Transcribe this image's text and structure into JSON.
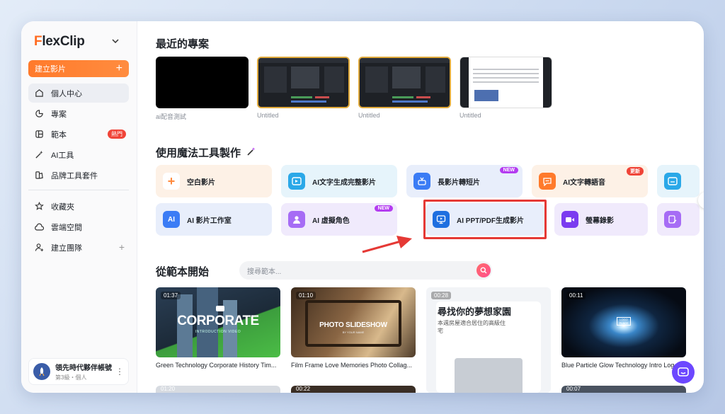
{
  "brand": {
    "name": "FlexClip",
    "first_letter": "F",
    "rest": "lexClip"
  },
  "sidebar": {
    "create_label": "建立影片",
    "items": [
      {
        "label": "個人中心",
        "icon": "home-icon",
        "active": true
      },
      {
        "label": "專案",
        "icon": "folder-icon"
      },
      {
        "label": "範本",
        "icon": "template-icon",
        "badge": "熱門"
      },
      {
        "label": "AI工具",
        "icon": "magic-wand-icon"
      },
      {
        "label": "品牌工具套件",
        "icon": "brand-kit-icon"
      },
      {
        "label": "收藏夾",
        "icon": "star-icon"
      },
      {
        "label": "雲端空間",
        "icon": "cloud-icon"
      },
      {
        "label": "建立團隊",
        "icon": "add-user-icon"
      }
    ],
    "account": {
      "name": "領先時代夥伴帳號",
      "sub": "第3級・個人"
    }
  },
  "recent": {
    "title": "最近的專案",
    "projects": [
      {
        "label": "ai配音測試"
      },
      {
        "label": "Untitled"
      },
      {
        "label": "Untitled"
      },
      {
        "label": "Untitled"
      }
    ]
  },
  "tools": {
    "title": "使用魔法工具製作",
    "items": [
      {
        "label": "空白影片",
        "icon": "plus-icon",
        "color": "#ff8a3d"
      },
      {
        "label": "AI文字生成完整影片",
        "icon": "ai-video-icon",
        "color": "#2aa8e8"
      },
      {
        "label": "長影片轉短片",
        "icon": "cut-icon",
        "color": "#3b7cf5",
        "badge": "NEW"
      },
      {
        "label": "AI文字轉語音",
        "icon": "speech-icon",
        "color": "#ff7a2b",
        "badge": "更新"
      },
      {
        "label": "",
        "icon": "image-icon",
        "color": "#2aa8e8"
      },
      {
        "label": "AI 影片工作室",
        "icon": "ai-studio-icon",
        "color": "#3b7cf5"
      },
      {
        "label": "AI 虛擬角色",
        "icon": "avatar-icon",
        "color": "#a66cf5",
        "badge": "NEW"
      },
      {
        "label": "AI PPT/PDF生成影片",
        "icon": "ppt-video-icon",
        "color": "#1e6fe0"
      },
      {
        "label": "螢幕錄影",
        "icon": "screen-record-icon",
        "color": "#7b3cf0"
      },
      {
        "label": "",
        "icon": "edit-icon",
        "color": "#a66cf5"
      }
    ]
  },
  "templates": {
    "title": "從範本開始",
    "search_placeholder": "搜尋範本...",
    "items": [
      {
        "duration": "01:37",
        "caption": "Green Technology Corporate History Tim...",
        "thumb_title": "CORPORATE",
        "thumb_sub": "INTRODUCTION VIDEO"
      },
      {
        "duration": "01:10",
        "caption": "Film Frame Love Memories Photo Collag...",
        "thumb_title": "PHOTO SLIDESHOW",
        "thumb_sub": "BY YOUR NAME"
      },
      {
        "duration": "00:28",
        "caption": "",
        "thumb_title": "尋找你的夢想家園",
        "thumb_sub": "本週房屋適合居住的高級住宅"
      },
      {
        "duration": "00:11",
        "caption": "Blue Particle Glow Technology Intro Log...",
        "thumb_title": "LOGO PLACE",
        "thumb_sub": ""
      }
    ],
    "row2": [
      "01:20",
      "00:22",
      "",
      "00:07"
    ]
  }
}
